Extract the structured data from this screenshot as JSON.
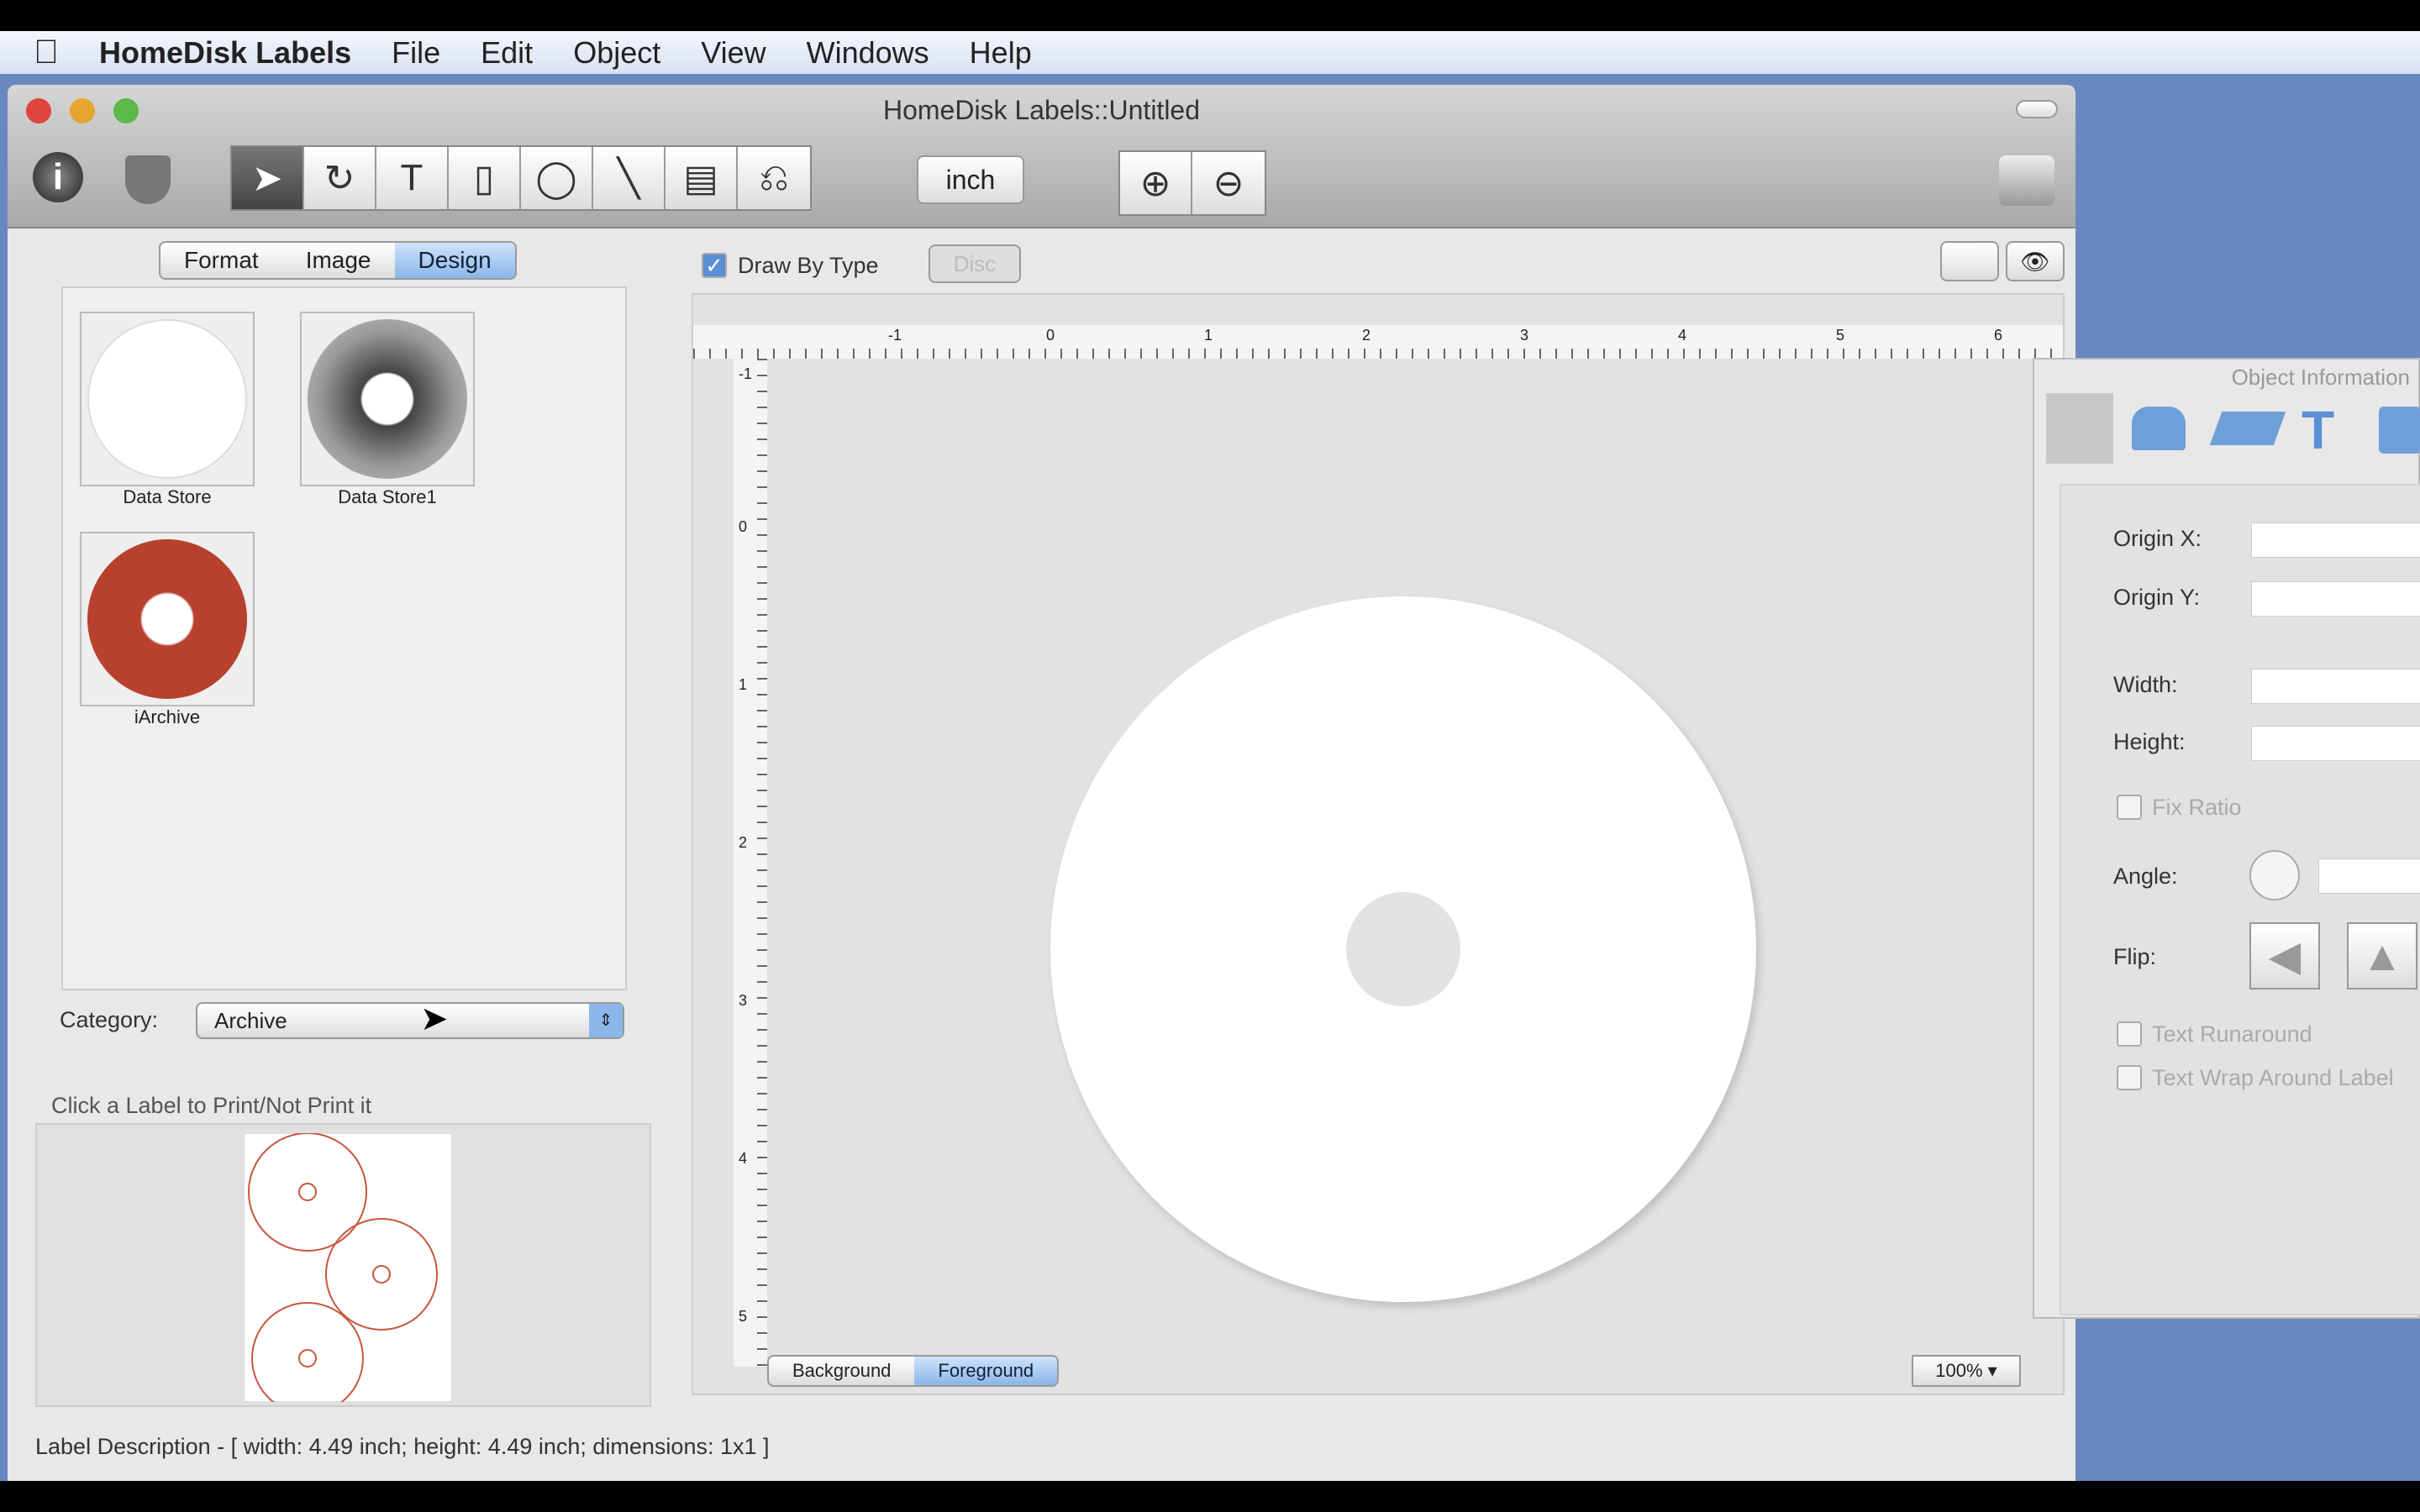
{
  "menubar": {
    "app": "HomeDisk Labels",
    "items": [
      "File",
      "Edit",
      "Object",
      "View",
      "Windows",
      "Help"
    ]
  },
  "window": {
    "title": "HomeDisk Labels::Untitled"
  },
  "toolbar": {
    "unit": "inch",
    "tools": [
      "select",
      "rotate",
      "text",
      "rectangle",
      "ellipse",
      "line",
      "barcode",
      "curve"
    ]
  },
  "left": {
    "tabs": [
      "Format",
      "Image",
      "Design"
    ],
    "active_tab": "Design",
    "templates": [
      {
        "name": "Data Store"
      },
      {
        "name": "Data Store1"
      },
      {
        "name": "iArchive"
      }
    ],
    "category_label": "Category:",
    "category_value": "Archive",
    "print_hint": "Click a Label to Print/Not Print it",
    "label_description": "Label Description - [ width: 4.49 inch; height: 4.49 inch; dimensions: 1x1 ]"
  },
  "canvas": {
    "draw_by_type": "Draw By Type",
    "draw_by_type_checked": true,
    "disc_button": "Disc",
    "ruler_h": [
      "-1",
      "0",
      "1",
      "2",
      "3",
      "4",
      "5",
      "6"
    ],
    "ruler_v": [
      "-1",
      "0",
      "1",
      "2",
      "3",
      "4",
      "5"
    ],
    "layers": [
      "Background",
      "Foreground"
    ],
    "active_layer": "Foreground",
    "zoom": "100%"
  },
  "object_info": {
    "title": "Object Information",
    "origin_x": "Origin X:",
    "origin_y": "Origin Y:",
    "width": "Width:",
    "height": "Height:",
    "fix_ratio": "Fix Ratio",
    "angle": "Angle:",
    "flip": "Flip:",
    "text_runaround": "Text Runaround",
    "text_wrap": "Text Wrap Around Label"
  },
  "colors": {
    "accent": "#8ab6ea",
    "desktop": "#6a88c0",
    "preview_outline": "#c8553d"
  }
}
